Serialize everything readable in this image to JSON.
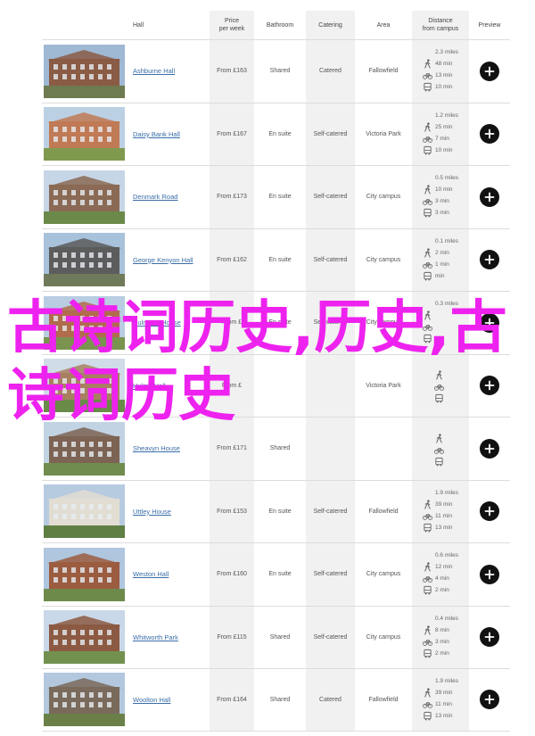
{
  "header": {
    "hall": "Hall",
    "price": "Price\nper week",
    "bathroom": "Bathroom",
    "catering": "Catering",
    "area": "Area",
    "distance": "Distance\nfrom campus",
    "preview": "Preview"
  },
  "colors": {
    "link": "#3a6ea8",
    "overlay": "#ee22ee",
    "shade": "#f1f1f1"
  },
  "icons": {
    "walk": "walk-icon",
    "bike": "bicycle-icon",
    "bus": "bus-icon",
    "preview": "plus-icon"
  },
  "halls": [
    {
      "name": "Ashburne Hall",
      "price": "From £163",
      "bathroom": "Shared",
      "catering": "Catered",
      "area": "Fallowfield",
      "miles": "2.3 miles",
      "walk": "48 min",
      "bike": "13 min",
      "bus": "10 min",
      "img": "a"
    },
    {
      "name": "Daisy Bank Hall",
      "price": "From £167",
      "bathroom": "En suite",
      "catering": "Self-catered",
      "area": "Victoria Park",
      "miles": "1.2 miles",
      "walk": "25 min",
      "bike": "7 min",
      "bus": "10 min",
      "img": "b"
    },
    {
      "name": "Denmark Road",
      "price": "From £173",
      "bathroom": "En suite",
      "catering": "Self-catered",
      "area": "City campus",
      "miles": "0.5 miles",
      "walk": "10 min",
      "bike": "3 min",
      "bus": "3 min",
      "img": "c"
    },
    {
      "name": "George Kenyon Hall",
      "price": "From £162",
      "bathroom": "En suite",
      "catering": "Self-catered",
      "area": "City campus",
      "miles": "0.1 miles",
      "walk": "2 min",
      "bike": "1 min",
      "bus": "min",
      "img": "d"
    },
    {
      "name": "Hulmann House",
      "price": "From £",
      "bathroom": "En suite",
      "catering": "Self-catered",
      "area": "City campus",
      "miles": "0.3 miles",
      "walk": "",
      "bike": "",
      "bus": "",
      "img": "e"
    },
    {
      "name": "Hulme Hall",
      "price": "From £",
      "bathroom": "",
      "catering": "",
      "area": "Victoria Park",
      "miles": "",
      "walk": "",
      "bike": "",
      "bus": "",
      "img": "f"
    },
    {
      "name": "Sheavyn House",
      "price": "From £171",
      "bathroom": "Shared",
      "catering": "",
      "area": "",
      "miles": "",
      "walk": "",
      "bike": "",
      "bus": "",
      "img": "g"
    },
    {
      "name": "Uttley House",
      "price": "From £153",
      "bathroom": "En suite",
      "catering": "Self-catered",
      "area": "Fallowfield",
      "miles": "1.9 miles",
      "walk": "39 min",
      "bike": "11 min",
      "bus": "13 min",
      "img": "h"
    },
    {
      "name": "Weston Hall",
      "price": "From £160",
      "bathroom": "En suite",
      "catering": "Self-catered",
      "area": "City campus",
      "miles": "0.6 miles",
      "walk": "12 min",
      "bike": "4 min",
      "bus": "2 min",
      "img": "i"
    },
    {
      "name": "Whitworth Park",
      "price": "From £115",
      "bathroom": "Shared",
      "catering": "Self-catered",
      "area": "City campus",
      "miles": "0.4 miles",
      "walk": "8 min",
      "bike": "3 min",
      "bus": "2 min",
      "img": "j"
    },
    {
      "name": "Woolton Hall",
      "price": "From £164",
      "bathroom": "Shared",
      "catering": "Catered",
      "area": "Fallowfield",
      "miles": "1.9 miles",
      "walk": "39 min",
      "bike": "11 min",
      "bus": "13 min",
      "img": "k"
    }
  ],
  "overlay_text": "古诗词历史,历史,古诗词历史"
}
